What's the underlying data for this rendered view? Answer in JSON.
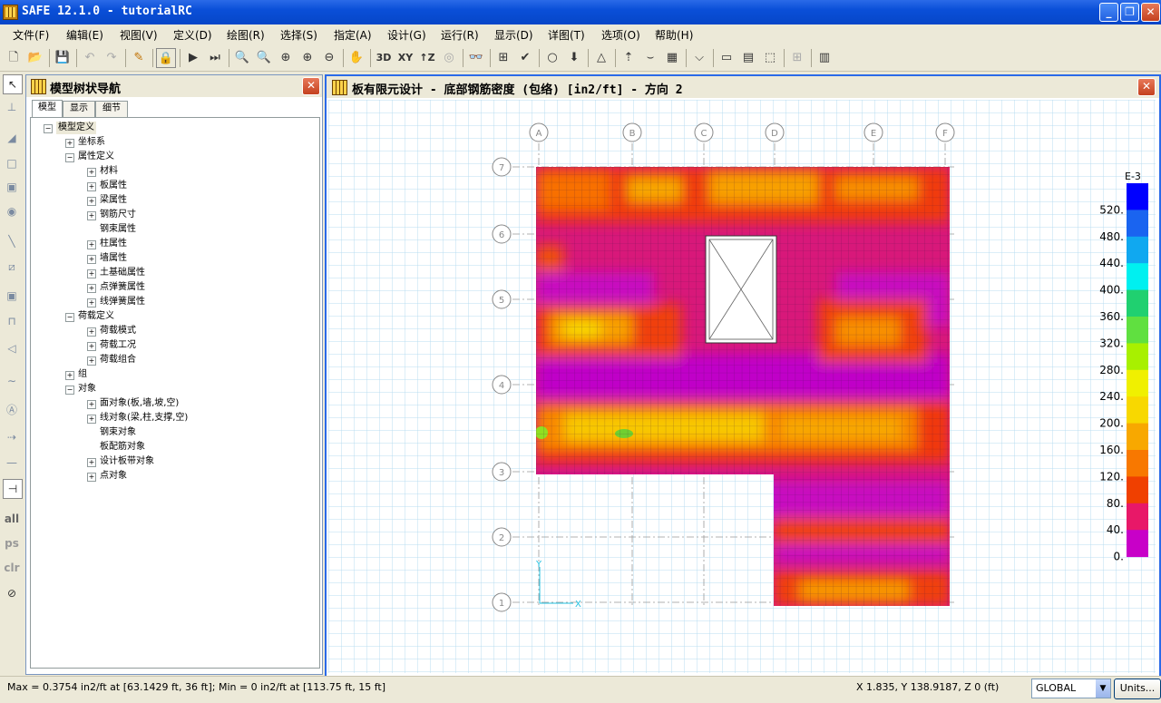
{
  "window": {
    "title": "SAFE  12.1.0 - tutorialRC"
  },
  "menu": [
    "文件(F)",
    "编辑(E)",
    "视图(V)",
    "定义(D)",
    "绘图(R)",
    "选择(S)",
    "指定(A)",
    "设计(G)",
    "运行(R)",
    "显示(D)",
    "详图(T)",
    "选项(O)",
    "帮助(H)"
  ],
  "toolbar": {
    "view_3d": "3D",
    "view_xy": "XY",
    "view_z": "↑Z"
  },
  "left_tools": {
    "all": "all",
    "ps": "ps",
    "clr": "clr"
  },
  "tree_panel": {
    "title": "模型树状导航",
    "tabs": [
      "模型",
      "显示",
      "细节"
    ],
    "nodes": [
      {
        "label": "模型定义",
        "level": 0,
        "exp": "−"
      },
      {
        "label": "坐标系",
        "level": 1,
        "exp": "+"
      },
      {
        "label": "属性定义",
        "level": 1,
        "exp": "−"
      },
      {
        "label": "材料",
        "level": 2,
        "exp": "+"
      },
      {
        "label": "板属性",
        "level": 2,
        "exp": "+"
      },
      {
        "label": "梁属性",
        "level": 2,
        "exp": "+"
      },
      {
        "label": "钢筋尺寸",
        "level": 2,
        "exp": "+"
      },
      {
        "label": "钢束属性",
        "level": 2,
        "exp": ""
      },
      {
        "label": "柱属性",
        "level": 2,
        "exp": "+"
      },
      {
        "label": "墙属性",
        "level": 2,
        "exp": "+"
      },
      {
        "label": "土基础属性",
        "level": 2,
        "exp": "+"
      },
      {
        "label": "点弹簧属性",
        "level": 2,
        "exp": "+"
      },
      {
        "label": "线弹簧属性",
        "level": 2,
        "exp": "+"
      },
      {
        "label": "荷载定义",
        "level": 1,
        "exp": "−"
      },
      {
        "label": "荷载模式",
        "level": 2,
        "exp": "+"
      },
      {
        "label": "荷载工况",
        "level": 2,
        "exp": "+"
      },
      {
        "label": "荷载组合",
        "level": 2,
        "exp": "+"
      },
      {
        "label": "组",
        "level": 1,
        "exp": "+"
      },
      {
        "label": "对象",
        "level": 1,
        "exp": "−"
      },
      {
        "label": "面对象(板,墙,坡,空)",
        "level": 2,
        "exp": "+"
      },
      {
        "label": "线对象(梁,柱,支撑,空)",
        "level": 2,
        "exp": "+"
      },
      {
        "label": "钢束对象",
        "level": 2,
        "exp": ""
      },
      {
        "label": "板配筋对象",
        "level": 2,
        "exp": ""
      },
      {
        "label": "设计板带对象",
        "level": 2,
        "exp": "+"
      },
      {
        "label": "点对象",
        "level": 2,
        "exp": "+"
      }
    ]
  },
  "view": {
    "title": "板有限元设计 - 底部钢筋密度 (包络) [in2/ft] - 方向 2",
    "grid_x_labels": [
      "A",
      "B",
      "C",
      "D",
      "E",
      "F"
    ],
    "grid_y_labels": [
      "7",
      "6",
      "5",
      "4",
      "3",
      "2",
      "1"
    ],
    "axis_labels": {
      "x": "X",
      "y": "Y"
    },
    "legend": {
      "exponent": "E-3",
      "labels": [
        "520.",
        "480.",
        "440.",
        "400.",
        "360.",
        "320.",
        "280.",
        "240.",
        "200.",
        "160.",
        "120.",
        "80.",
        "40.",
        "0."
      ],
      "colors": [
        "#0000ff",
        "#1a64f0",
        "#10a8f0",
        "#00f0f0",
        "#20d070",
        "#60e040",
        "#a8f000",
        "#f0f000",
        "#f8d800",
        "#f8a800",
        "#f87800",
        "#f04000",
        "#e81868",
        "#c800c8"
      ]
    }
  },
  "status": {
    "left": "Max = 0.3754 in2/ft at [63.1429 ft, 36 ft];  Min = 0 in2/ft at [113.75 ft, 15 ft]",
    "coords": "X 1.835,  Y 138.9187,  Z 0  (ft)",
    "coord_system": "GLOBAL",
    "units_button": "Units..."
  }
}
